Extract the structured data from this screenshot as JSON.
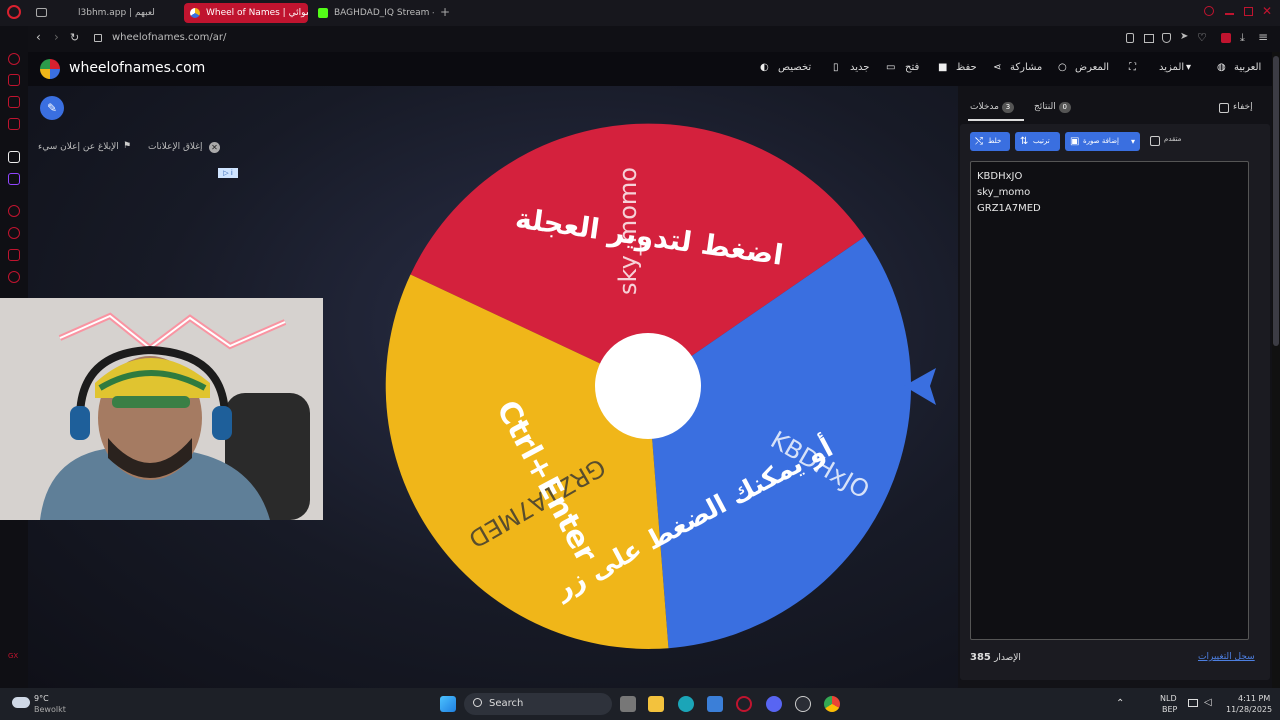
{
  "browser": {
    "tabs": [
      {
        "title": "l3bhm.app | لعبهم",
        "active": false
      },
      {
        "title": "Wheel of Names | عشوائي",
        "active": true
      },
      {
        "title": "BAGHDAD_IQ Stream - W",
        "active": false
      }
    ],
    "url": "wheelofnames.com/ar/"
  },
  "site": {
    "name": "wheelofnames.com",
    "nav": {
      "customize": "تخصيص",
      "new": "جديد",
      "open": "فتح",
      "save": "حفظ",
      "share": "مشاركة",
      "gallery": "المعرض",
      "more": "المزيد",
      "language": "العربية"
    }
  },
  "ads": {
    "close_ads": "إغلاق الإعلانات",
    "report_ad": "الإبلاغ عن إعلان سيء"
  },
  "wheel": {
    "overlay_line1": "اضغط لتدوير العجلة",
    "overlay_line2": "أو يمكنك الضغط على زر",
    "overlay_shortcut": "Ctrl+Enter",
    "segments": [
      {
        "label": "sky_momo",
        "color": "#d4213d"
      },
      {
        "label": "KBDHxJO",
        "color": "#3a6fe0"
      },
      {
        "label": "GRZ1A7MED",
        "color": "#f0b619"
      }
    ]
  },
  "panel": {
    "tab_entries": "مدخلات",
    "tab_entries_count": "3",
    "tab_results": "النتائج",
    "tab_results_count": "0",
    "hide": "إخفاء",
    "btn_shuffle": "خلط",
    "btn_sort": "ترتيب",
    "btn_add_image": "إضافة صورة",
    "advanced": "متقدم",
    "entries": [
      "KBDHxJO",
      "sky_momo",
      "GRZ1A7MED"
    ],
    "version_label": "الإصدار",
    "version_number": "385",
    "changelog": "سجل التغييرات"
  },
  "taskbar": {
    "weather_temp": "9°C",
    "weather_desc": "Bewolkt",
    "search_placeholder": "Search",
    "lang_top": "NLD",
    "lang_bottom": "BEP",
    "time": "4:11 PM",
    "date": "11/28/2025"
  }
}
